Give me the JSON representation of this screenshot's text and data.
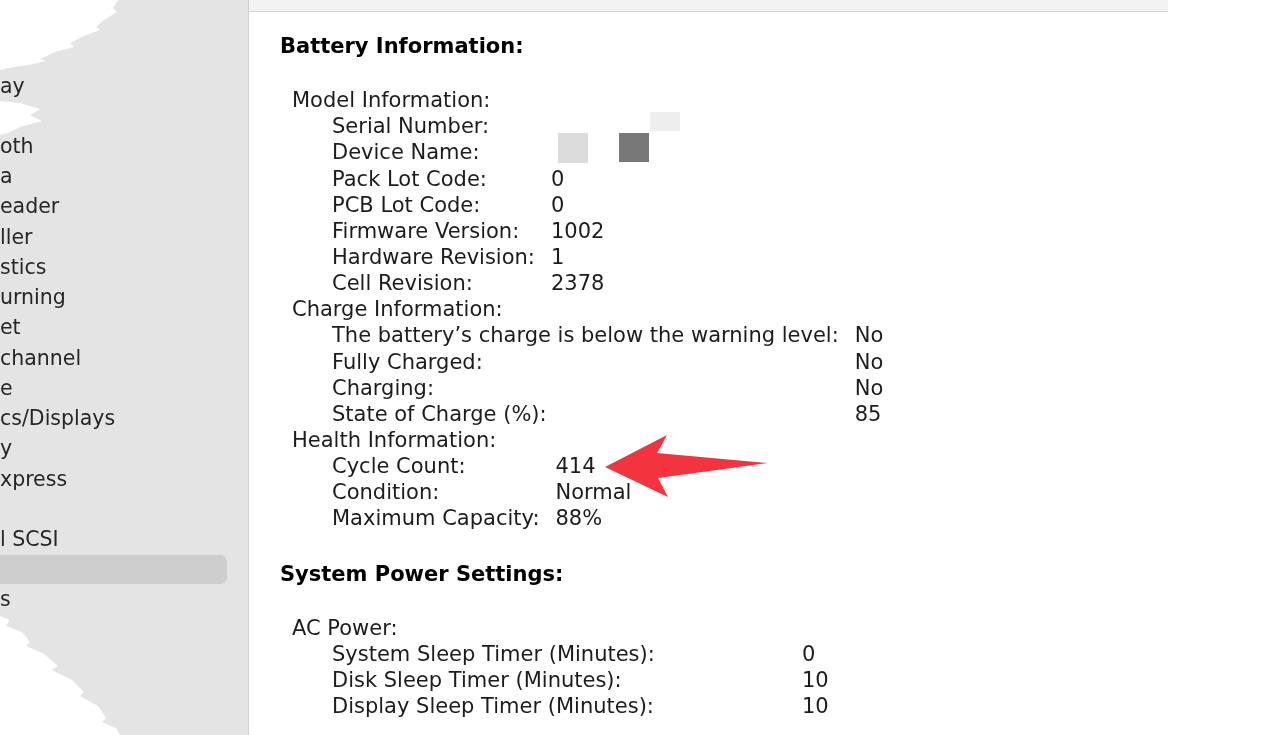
{
  "sidebar": {
    "items": [
      {
        "kind": "entry",
        "label": "ay",
        "selected": false
      },
      {
        "kind": "gap"
      },
      {
        "kind": "entry",
        "label": "oth",
        "selected": false
      },
      {
        "kind": "entry",
        "label": "a",
        "selected": false
      },
      {
        "kind": "entry",
        "label": "eader",
        "selected": false
      },
      {
        "kind": "entry",
        "label": "ller",
        "selected": false
      },
      {
        "kind": "entry",
        "label": "stics",
        "selected": false
      },
      {
        "kind": "entry",
        "label": "urning",
        "selected": false
      },
      {
        "kind": "entry",
        "label": "et",
        "selected": false
      },
      {
        "kind": "entry",
        "label": "channel",
        "selected": false
      },
      {
        "kind": "entry",
        "label": "e",
        "selected": false
      },
      {
        "kind": "entry",
        "label": "cs/Displays",
        "selected": false
      },
      {
        "kind": "entry",
        "label": "y",
        "selected": false
      },
      {
        "kind": "entry",
        "label": "xpress",
        "selected": false
      },
      {
        "kind": "gap"
      },
      {
        "kind": "entry",
        "label": "l SCSI",
        "selected": false
      },
      {
        "kind": "entry",
        "selected": true
      },
      {
        "kind": "entry",
        "label": "s",
        "selected": false
      }
    ]
  },
  "report": {
    "sections": [
      {
        "title": "Battery Information:",
        "groups": [
          {
            "heading": "Model Information:",
            "rows": [
              {
                "label": "Serial Number:",
                "kind": "blurred"
              },
              {
                "label": "Device Name:",
                "kind": "masked"
              },
              {
                "label": "Pack Lot Code:",
                "kind": "text",
                "value": "0"
              },
              {
                "label": "PCB Lot Code:",
                "kind": "text",
                "value": "0"
              },
              {
                "label": "Firmware Version:",
                "kind": "text",
                "value": "1002"
              },
              {
                "label": "Hardware Revision:",
                "kind": "text",
                "value": "1"
              },
              {
                "label": "Cell Revision:",
                "kind": "text",
                "value": "2378"
              }
            ]
          },
          {
            "heading": "Charge Information:",
            "rows": [
              {
                "label": "The battery’s charge is below the warning level:",
                "kind": "text",
                "value": "No"
              },
              {
                "label": "Fully Charged:",
                "kind": "text",
                "value": "No"
              },
              {
                "label": "Charging:",
                "kind": "text",
                "value": "No"
              },
              {
                "label": "State of Charge (%):",
                "kind": "text",
                "value": "85"
              }
            ]
          },
          {
            "heading": "Health Information:",
            "rows": [
              {
                "label": "Cycle Count:",
                "kind": "text",
                "value": "414"
              },
              {
                "label": "Condition:",
                "kind": "text",
                "value": "Normal"
              },
              {
                "label": "Maximum Capacity:",
                "kind": "text",
                "value": "88%"
              }
            ]
          }
        ]
      },
      {
        "title": "System Power Settings:",
        "groups": [
          {
            "heading": "AC Power:",
            "rows": [
              {
                "label": "System Sleep Timer (Minutes):",
                "kind": "text",
                "value": "0"
              },
              {
                "label": "Disk Sleep Timer (Minutes):",
                "kind": "text",
                "value": "10"
              },
              {
                "label": "Display Sleep Timer (Minutes):",
                "kind": "text",
                "value": "10"
              }
            ]
          }
        ]
      }
    ]
  }
}
